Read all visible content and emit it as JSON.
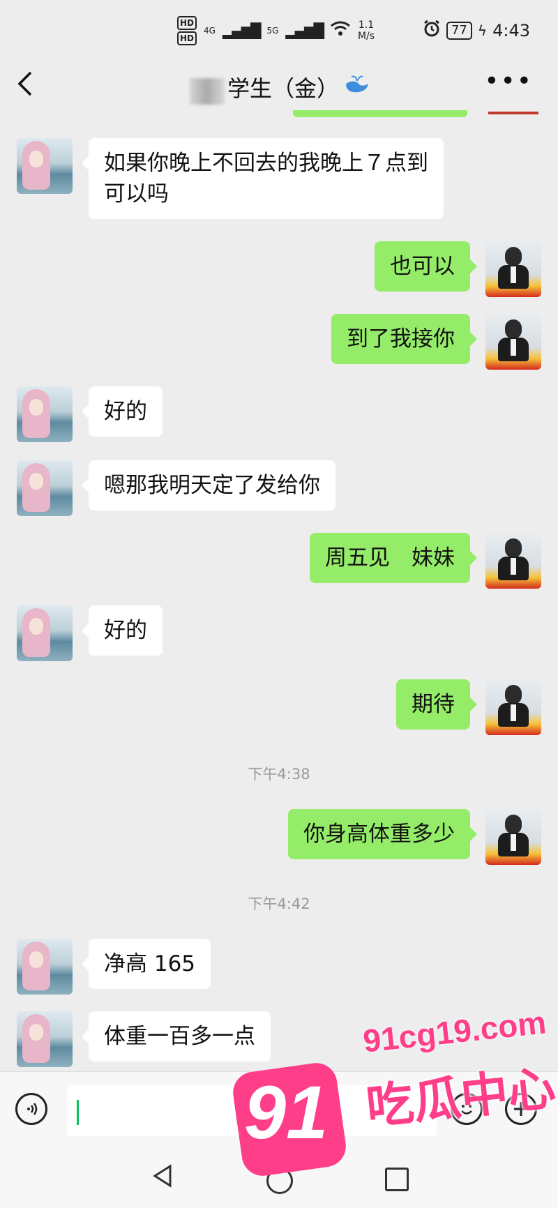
{
  "status_bar": {
    "hd1": "HD",
    "hd2": "HD",
    "net1": "4G",
    "net2": "5G",
    "speed": "1.1",
    "speed_unit": "M/s",
    "battery": "77",
    "time": "4:43"
  },
  "nav": {
    "back_icon": "chevron-left-icon",
    "title": "学生（金）",
    "more_icon": "ellipsis-icon"
  },
  "messages": [
    {
      "side": "left",
      "lines": [
        "如果你晚上不回去的我晚上７点到",
        "可以吗"
      ]
    },
    {
      "side": "right",
      "lines": [
        "也可以"
      ]
    },
    {
      "side": "right",
      "lines": [
        "到了我接你"
      ]
    },
    {
      "side": "left",
      "lines": [
        "好的"
      ]
    },
    {
      "side": "left",
      "lines": [
        "嗯那我明天定了发给你"
      ]
    },
    {
      "side": "right",
      "lines": [
        "周五见　妹妹"
      ]
    },
    {
      "side": "left",
      "lines": [
        "好的"
      ]
    },
    {
      "side": "right",
      "lines": [
        "期待"
      ]
    },
    {
      "timestamp": "下午4:38"
    },
    {
      "side": "right",
      "lines": [
        "你身高体重多少"
      ]
    },
    {
      "timestamp": "下午4:42"
    },
    {
      "side": "left",
      "lines": [
        "净高 165"
      ]
    },
    {
      "side": "left",
      "lines": [
        "体重一百多一点"
      ]
    }
  ],
  "input_bar": {
    "voice_icon": "voice-icon",
    "emoji_icon": "emoji-icon",
    "plus_icon": "plus-icon",
    "text_value": ""
  },
  "system_nav": {
    "back_icon": "triangle-back-icon",
    "home_icon": "circle-home-icon",
    "recent_icon": "square-recent-icon"
  },
  "watermark": {
    "badge_number": "91",
    "url": "91cg19.com",
    "text": "吃瓜中心"
  },
  "colors": {
    "background": "#ededed",
    "sent_bubble": "#95ec69",
    "received_bubble": "#ffffff",
    "watermark_pink": "#ff3e8a"
  }
}
